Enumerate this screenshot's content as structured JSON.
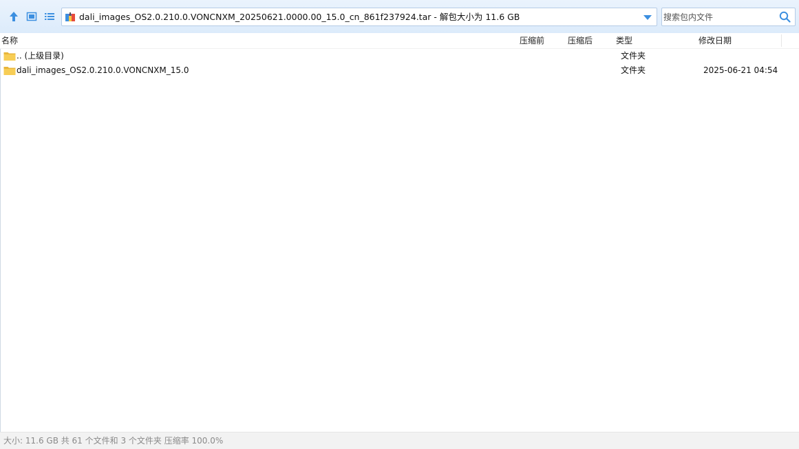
{
  "toolbar": {
    "up_icon": "arrow-up-icon",
    "view_icon": "single-pane-view-icon",
    "list_icon": "list-view-icon",
    "path": "dali_images_OS2.0.210.0.VONCNXM_20250621.0000.00_15.0_cn_861f237924.tar - 解包大小为 11.6 GB",
    "search_placeholder": "搜索包内文件"
  },
  "columns": {
    "name": "名称",
    "before": "压缩前",
    "after": "压缩后",
    "type": "类型",
    "modified": "修改日期"
  },
  "rows": [
    {
      "name": ".. (上级目录)",
      "type": "文件夹",
      "modified": "",
      "icon": "folder-icon"
    },
    {
      "name": "dali_images_OS2.0.210.0.VONCNXM_15.0",
      "type": "文件夹",
      "modified": "2025-06-21 04:54",
      "icon": "folder-icon"
    }
  ],
  "status": "大小: 11.6 GB 共 61 个文件和 3 个文件夹 压缩率 100.0%",
  "colors": {
    "accent": "#3c8fe0",
    "folder": "#f5c742",
    "toolbar_bg": "#dcebfb",
    "status_text": "#8a8a8a"
  }
}
